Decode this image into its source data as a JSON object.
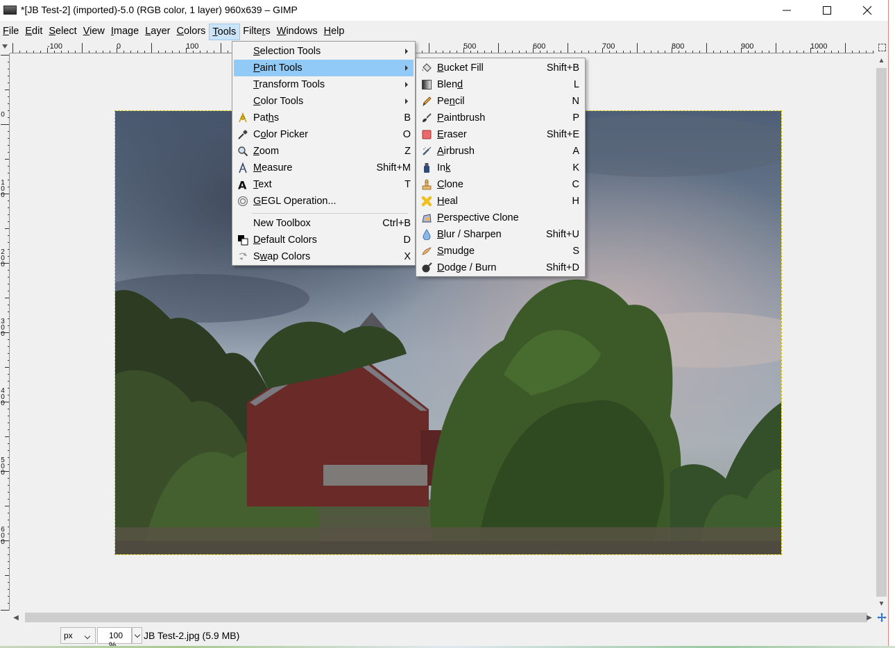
{
  "window": {
    "title": "*[JB Test-2] (imported)-5.0 (RGB color, 1 layer) 960x639 – GIMP",
    "minimize_icon": "minimize-icon",
    "maximize_icon": "maximize-icon",
    "close_icon": "close-icon"
  },
  "menubar": {
    "items": [
      {
        "label": "File",
        "mnemonic": "F",
        "rest": "ile"
      },
      {
        "label": "Edit",
        "mnemonic": "E",
        "rest": "dit"
      },
      {
        "label": "Select",
        "mnemonic": "S",
        "rest": "elect"
      },
      {
        "label": "View",
        "mnemonic": "V",
        "rest": "iew"
      },
      {
        "label": "Image",
        "mnemonic": "I",
        "rest": "mage"
      },
      {
        "label": "Layer",
        "mnemonic": "L",
        "rest": "ayer"
      },
      {
        "label": "Colors",
        "mnemonic": "C",
        "rest": "olors"
      },
      {
        "label": "Tools",
        "mnemonic": "T",
        "rest": "ools",
        "open": true
      },
      {
        "label": "Filters",
        "pre": "Filte",
        "mnemonic": "r",
        "rest": "s"
      },
      {
        "label": "Windows",
        "mnemonic": "W",
        "rest": "indows"
      },
      {
        "label": "Help",
        "mnemonic": "H",
        "rest": "elp"
      }
    ]
  },
  "ruler": {
    "h_labels": [
      "-100",
      "0",
      "100",
      "500",
      "600",
      "700",
      "800",
      "900",
      "1000"
    ],
    "v_labels": [
      "0",
      "1 0 0",
      "2 0 0",
      "3 0 0",
      "4 0 0",
      "5 0 0",
      "6 0 0"
    ]
  },
  "tools_menu": {
    "items": [
      {
        "pre": "",
        "mnemonic": "S",
        "rest": "election Tools",
        "submenu": true,
        "icon": ""
      },
      {
        "pre": "",
        "mnemonic": "P",
        "rest": "aint Tools",
        "submenu": true,
        "highlighted": true,
        "icon": ""
      },
      {
        "pre": "",
        "mnemonic": "T",
        "rest": "ransform Tools",
        "submenu": true,
        "icon": ""
      },
      {
        "pre": "",
        "mnemonic": "C",
        "rest": "olor Tools",
        "submenu": true,
        "icon": ""
      },
      {
        "pre": "Pat",
        "mnemonic": "h",
        "rest": "s",
        "shortcut": "B",
        "icon": "paths-icon"
      },
      {
        "pre": "C",
        "mnemonic": "o",
        "rest": "lor Picker",
        "shortcut": "O",
        "icon": "color-picker-icon"
      },
      {
        "pre": "",
        "mnemonic": "Z",
        "rest": "oom",
        "shortcut": "Z",
        "icon": "zoom-icon"
      },
      {
        "pre": "",
        "mnemonic": "M",
        "rest": "easure",
        "shortcut": "Shift+M",
        "icon": "measure-icon"
      },
      {
        "pre": "",
        "mnemonic": "T",
        "rest": "ext",
        "shortcut": "T",
        "icon": "text-icon"
      },
      {
        "pre": "",
        "mnemonic": "G",
        "rest": "EGL Operation...",
        "shortcut": "",
        "icon": "gegl-icon"
      },
      {
        "separator": true
      },
      {
        "pre": "New Toolbox",
        "mnemonic": "",
        "rest": "",
        "shortcut": "Ctrl+B",
        "icon": ""
      },
      {
        "pre": "",
        "mnemonic": "D",
        "rest": "efault Colors",
        "shortcut": "D",
        "icon": "default-colors-icon"
      },
      {
        "pre": "S",
        "mnemonic": "w",
        "rest": "ap Colors",
        "shortcut": "X",
        "icon": "swap-colors-icon"
      }
    ]
  },
  "paint_menu": {
    "items": [
      {
        "pre": "",
        "mnemonic": "B",
        "rest": "ucket Fill",
        "shortcut": "Shift+B",
        "icon": "bucket-fill-icon"
      },
      {
        "pre": "Blen",
        "mnemonic": "d",
        "rest": "",
        "shortcut": "L",
        "icon": "blend-icon"
      },
      {
        "pre": "Pe",
        "mnemonic": "n",
        "rest": "cil",
        "shortcut": "N",
        "icon": "pencil-icon"
      },
      {
        "pre": "",
        "mnemonic": "P",
        "rest": "aintbrush",
        "shortcut": "P",
        "icon": "paintbrush-icon"
      },
      {
        "pre": "",
        "mnemonic": "E",
        "rest": "raser",
        "shortcut": "Shift+E",
        "icon": "eraser-icon"
      },
      {
        "pre": "",
        "mnemonic": "A",
        "rest": "irbrush",
        "shortcut": "A",
        "icon": "airbrush-icon"
      },
      {
        "pre": "In",
        "mnemonic": "k",
        "rest": "",
        "shortcut": "K",
        "icon": "ink-icon"
      },
      {
        "pre": "",
        "mnemonic": "C",
        "rest": "lone",
        "shortcut": "C",
        "icon": "clone-icon"
      },
      {
        "pre": "",
        "mnemonic": "H",
        "rest": "eal",
        "shortcut": "H",
        "icon": "heal-icon"
      },
      {
        "pre": "",
        "mnemonic": "P",
        "rest": "erspective Clone",
        "shortcut": "",
        "icon": "perspective-clone-icon"
      },
      {
        "pre": "",
        "mnemonic": "B",
        "rest": "lur / Sharpen",
        "shortcut": "Shift+U",
        "icon": "blur-sharpen-icon"
      },
      {
        "pre": "",
        "mnemonic": "S",
        "rest": "mudge",
        "shortcut": "S",
        "icon": "smudge-icon"
      },
      {
        "pre": "",
        "mnemonic": "D",
        "rest": "odge / Burn",
        "shortcut": "Shift+D",
        "icon": "dodge-burn-icon"
      }
    ]
  },
  "statusbar": {
    "unit": "px",
    "zoom": "100 %",
    "file_info": "JB Test-2.jpg (5.9 MB)"
  },
  "colors": {
    "menu_highlight": "#91c9f7",
    "menubar_open": "#cce4f7",
    "selection_outline": "#d4c400"
  }
}
